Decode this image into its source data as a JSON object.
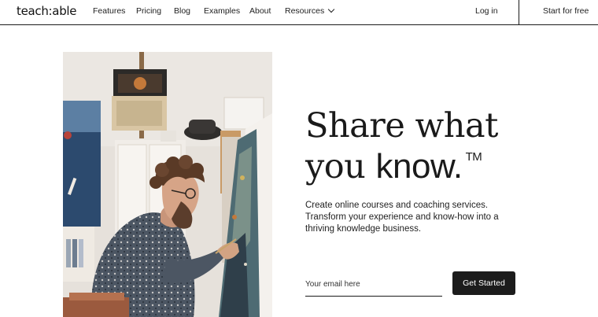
{
  "nav": {
    "logo": "teach:able",
    "links": [
      "Features",
      "Pricing",
      "Blog",
      "Examples",
      "About",
      "Resources"
    ],
    "login": "Log in",
    "start": "Start for free"
  },
  "hero": {
    "headline_line1": "Share what",
    "headline_line2_light": "you ",
    "headline_line2_bold": "know.",
    "trademark": "TM",
    "subtext": "Create online courses and coaching services. Transform your experience and know-how into a thriving knowledge business.",
    "email_placeholder": "Your email here",
    "cta": "Get Started"
  },
  "image": {
    "alt": "Man painting on a canvas in an art studio"
  }
}
